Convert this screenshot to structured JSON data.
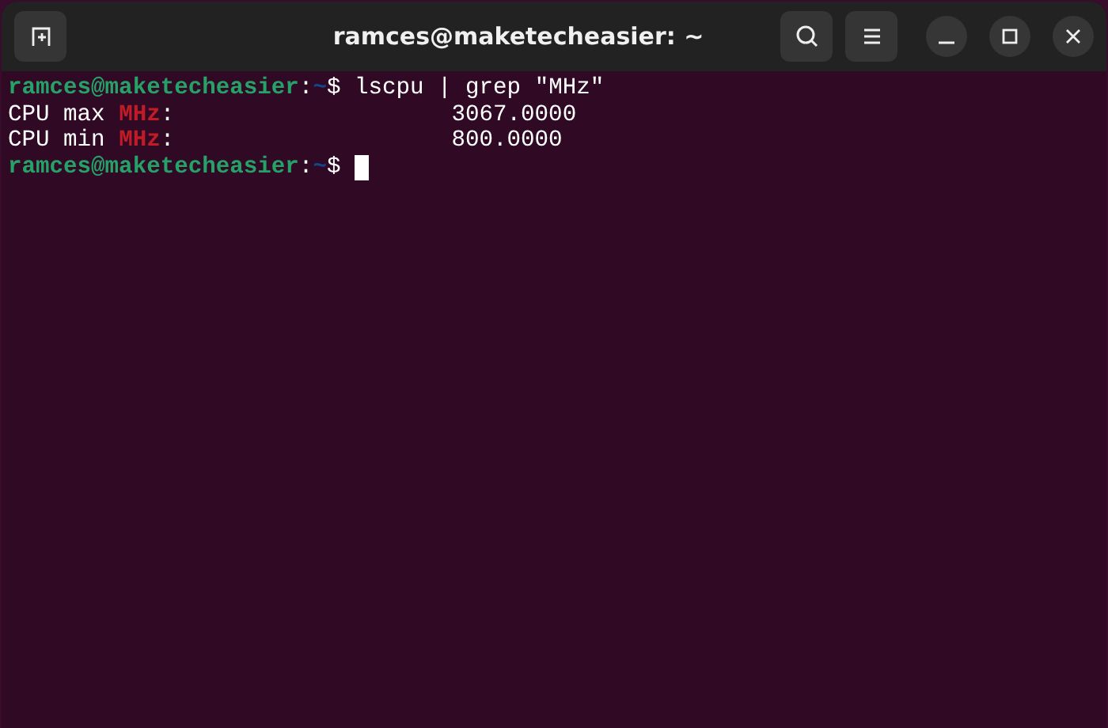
{
  "window": {
    "title": "ramces@maketecheasier: ~"
  },
  "terminal": {
    "lines": [
      {
        "segments": [
          {
            "kind": "user",
            "text": "ramces@maketecheasier"
          },
          {
            "kind": "plain",
            "text": ":"
          },
          {
            "kind": "path",
            "text": "~"
          },
          {
            "kind": "plain",
            "text": "$ lscpu | grep \"MHz\""
          }
        ]
      },
      {
        "segments": [
          {
            "kind": "plain",
            "text": "CPU max "
          },
          {
            "kind": "match",
            "text": "MHz"
          },
          {
            "kind": "plain",
            "text": ":                    3067.0000"
          }
        ]
      },
      {
        "segments": [
          {
            "kind": "plain",
            "text": "CPU min "
          },
          {
            "kind": "match",
            "text": "MHz"
          },
          {
            "kind": "plain",
            "text": ":                    800.0000"
          }
        ]
      },
      {
        "segments": [
          {
            "kind": "user",
            "text": "ramces@maketecheasier"
          },
          {
            "kind": "plain",
            "text": ":"
          },
          {
            "kind": "path",
            "text": "~"
          },
          {
            "kind": "plain",
            "text": "$ "
          }
        ],
        "cursor": true
      }
    ]
  }
}
